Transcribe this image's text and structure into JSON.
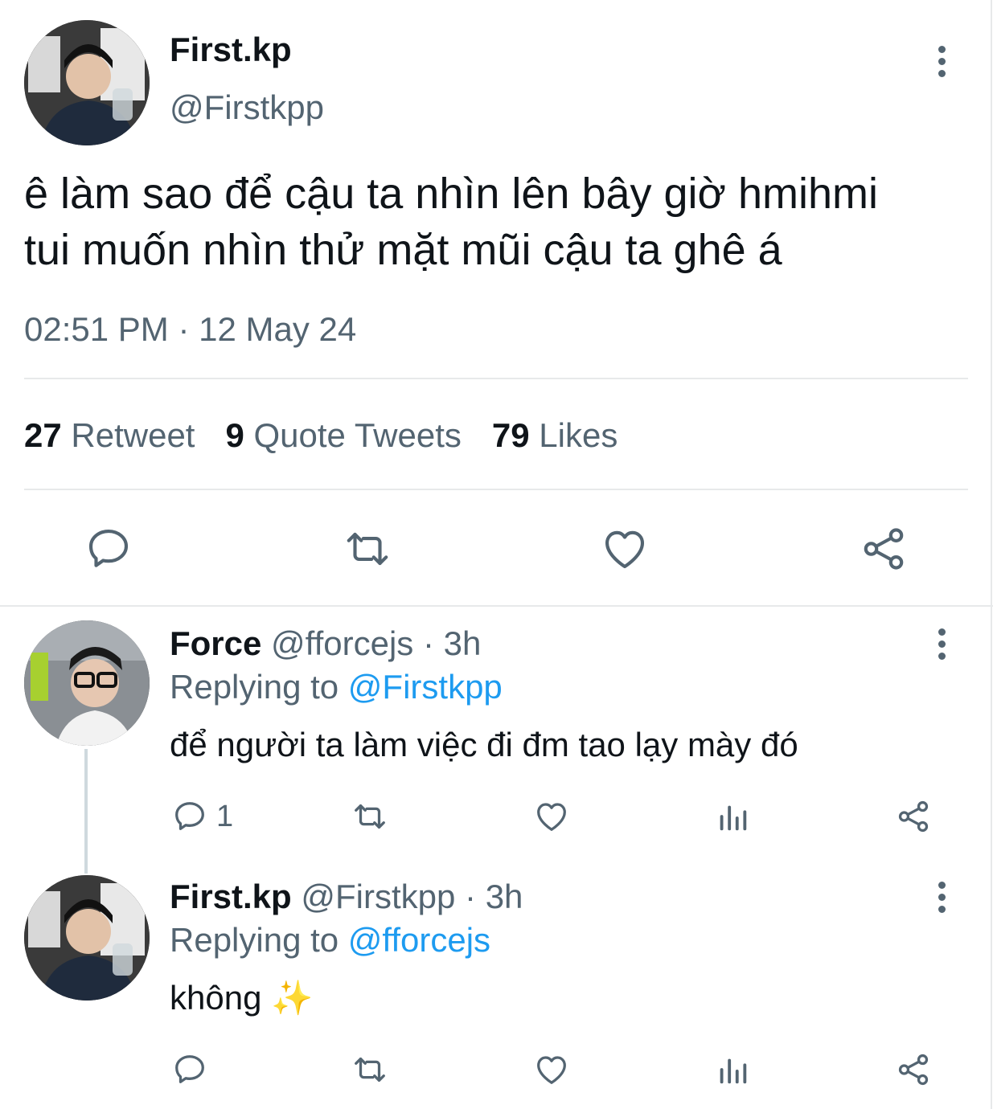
{
  "main_tweet": {
    "display_name": "First.kp",
    "handle": "@Firstkpp",
    "text_line1": "ê làm sao để cậu ta nhìn lên bây giờ hmihmi",
    "text_line2": "tui muốn nhìn thử mặt mũi cậu ta ghê á",
    "timestamp": "02:51 PM · 12 May 24",
    "stats": {
      "retweets_count": "27",
      "retweets_label": "Retweet",
      "quotes_count": "9",
      "quotes_label": "Quote Tweets",
      "likes_count": "79",
      "likes_label": "Likes"
    },
    "actions": [
      "reply-icon",
      "retweet-icon",
      "like-icon",
      "share-icon"
    ]
  },
  "replies": [
    {
      "display_name": "Force",
      "handle": "@fforcejs",
      "time": "· 3h",
      "replying_label": "Replying to",
      "replying_to": "@Firstkpp",
      "text": "để người ta làm việc đi đm tao lạy mày đó",
      "reply_count": "1"
    },
    {
      "display_name": "First.kp",
      "handle": "@Firstkpp",
      "time": "· 3h",
      "replying_label": "Replying to",
      "replying_to": "@fforcejs",
      "text": "không",
      "emoji": "✨",
      "reply_count": ""
    }
  ],
  "colors": {
    "accent": "#1d9bf0",
    "secondary_text": "#536471",
    "divider": "#e7e9ea"
  }
}
